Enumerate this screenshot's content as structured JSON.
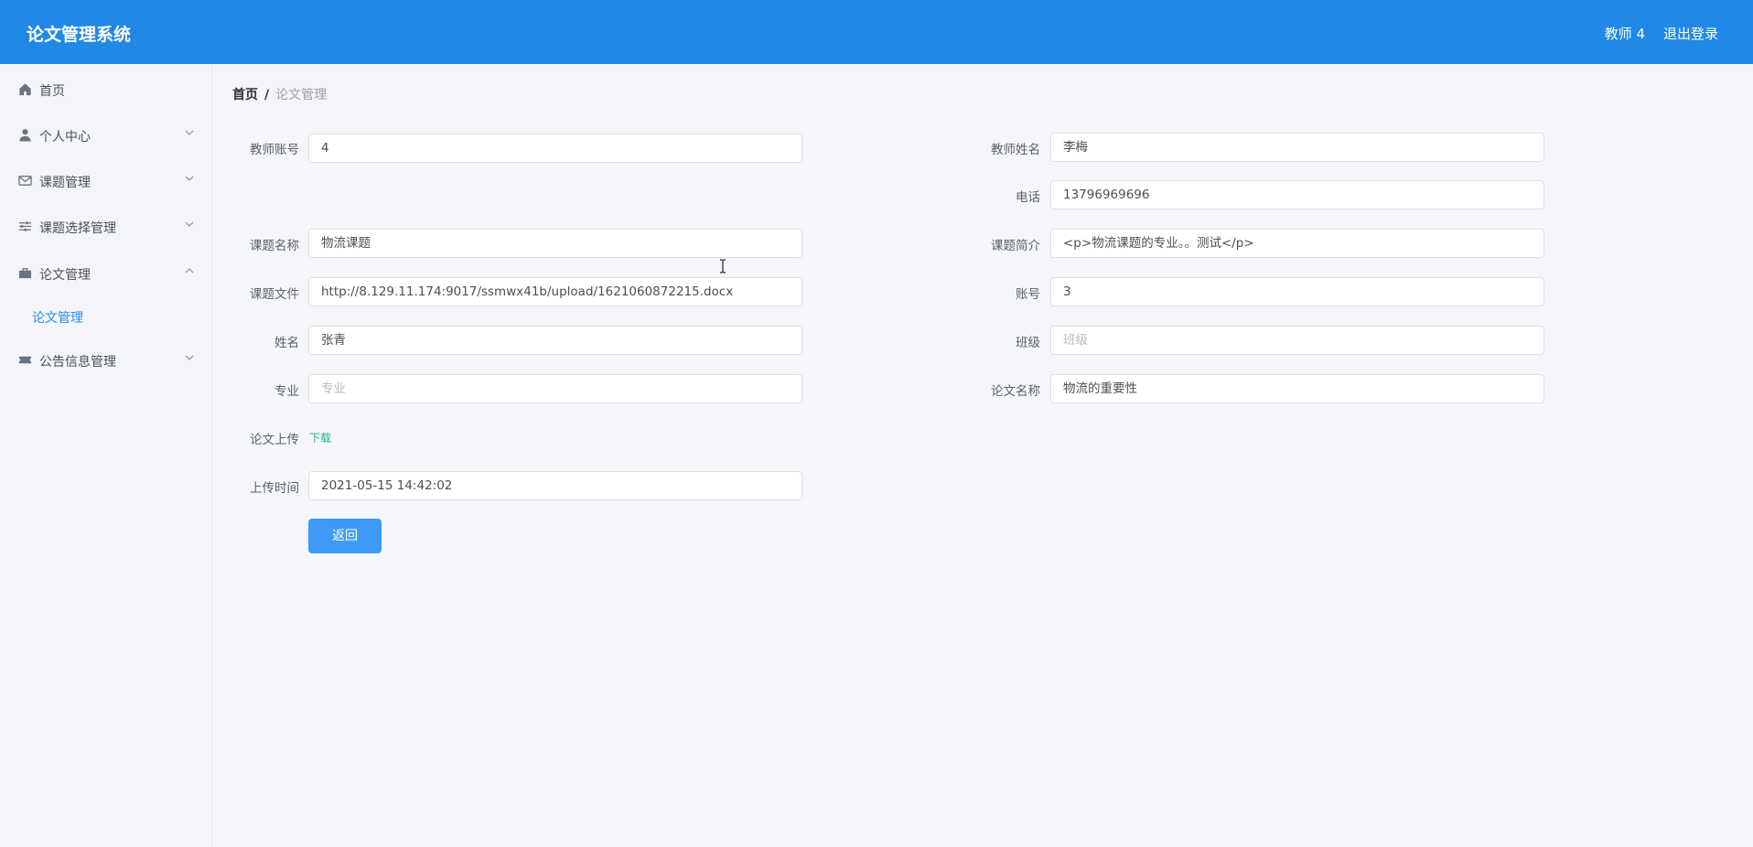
{
  "header": {
    "title": "论文管理系统",
    "user": "教师 4",
    "logout": "退出登录",
    "color": "#2088e5"
  },
  "sidebar": {
    "items": [
      {
        "label": "首页",
        "icon": "home-icon"
      },
      {
        "label": "个人中心",
        "icon": "user-icon",
        "expanded": false
      },
      {
        "label": "课题管理",
        "icon": "mail-icon",
        "expanded": false
      },
      {
        "label": "课题选择管理",
        "icon": "sliders-icon",
        "expanded": false
      },
      {
        "label": "论文管理",
        "icon": "briefcase-icon",
        "expanded": true,
        "children": [
          "论文管理"
        ]
      },
      {
        "label": "公告信息管理",
        "icon": "ticket-icon",
        "expanded": false
      }
    ]
  },
  "breadcrumb": {
    "home": "首页",
    "separator": "/",
    "current": "论文管理"
  },
  "form": {
    "teacher_account": {
      "label": "教师账号",
      "value": "4"
    },
    "teacher_name": {
      "label": "教师姓名",
      "value": "李梅"
    },
    "phone": {
      "label": "电话",
      "value": "13796969696"
    },
    "topic_name": {
      "label": "课题名称",
      "value": "物流课题"
    },
    "topic_intro": {
      "label": "课题简介",
      "value": "<p>物流课题的专业。。测试</p>"
    },
    "topic_file": {
      "label": "课题文件",
      "value": "http://8.129.11.174:9017/ssmwx41b/upload/1621060872215.docx"
    },
    "account": {
      "label": "账号",
      "value": "3"
    },
    "name": {
      "label": "姓名",
      "value": "张青"
    },
    "class": {
      "label": "班级",
      "placeholder": "班级"
    },
    "major": {
      "label": "专业",
      "placeholder": "专业"
    },
    "thesis_name": {
      "label": "论文名称",
      "value": "物流的重要性"
    },
    "thesis_upload": {
      "label": "论文上传",
      "link": "下载"
    },
    "upload_time": {
      "label": "上传时间",
      "value": "2021-05-15 14:42:02"
    },
    "back_button": "返回"
  }
}
